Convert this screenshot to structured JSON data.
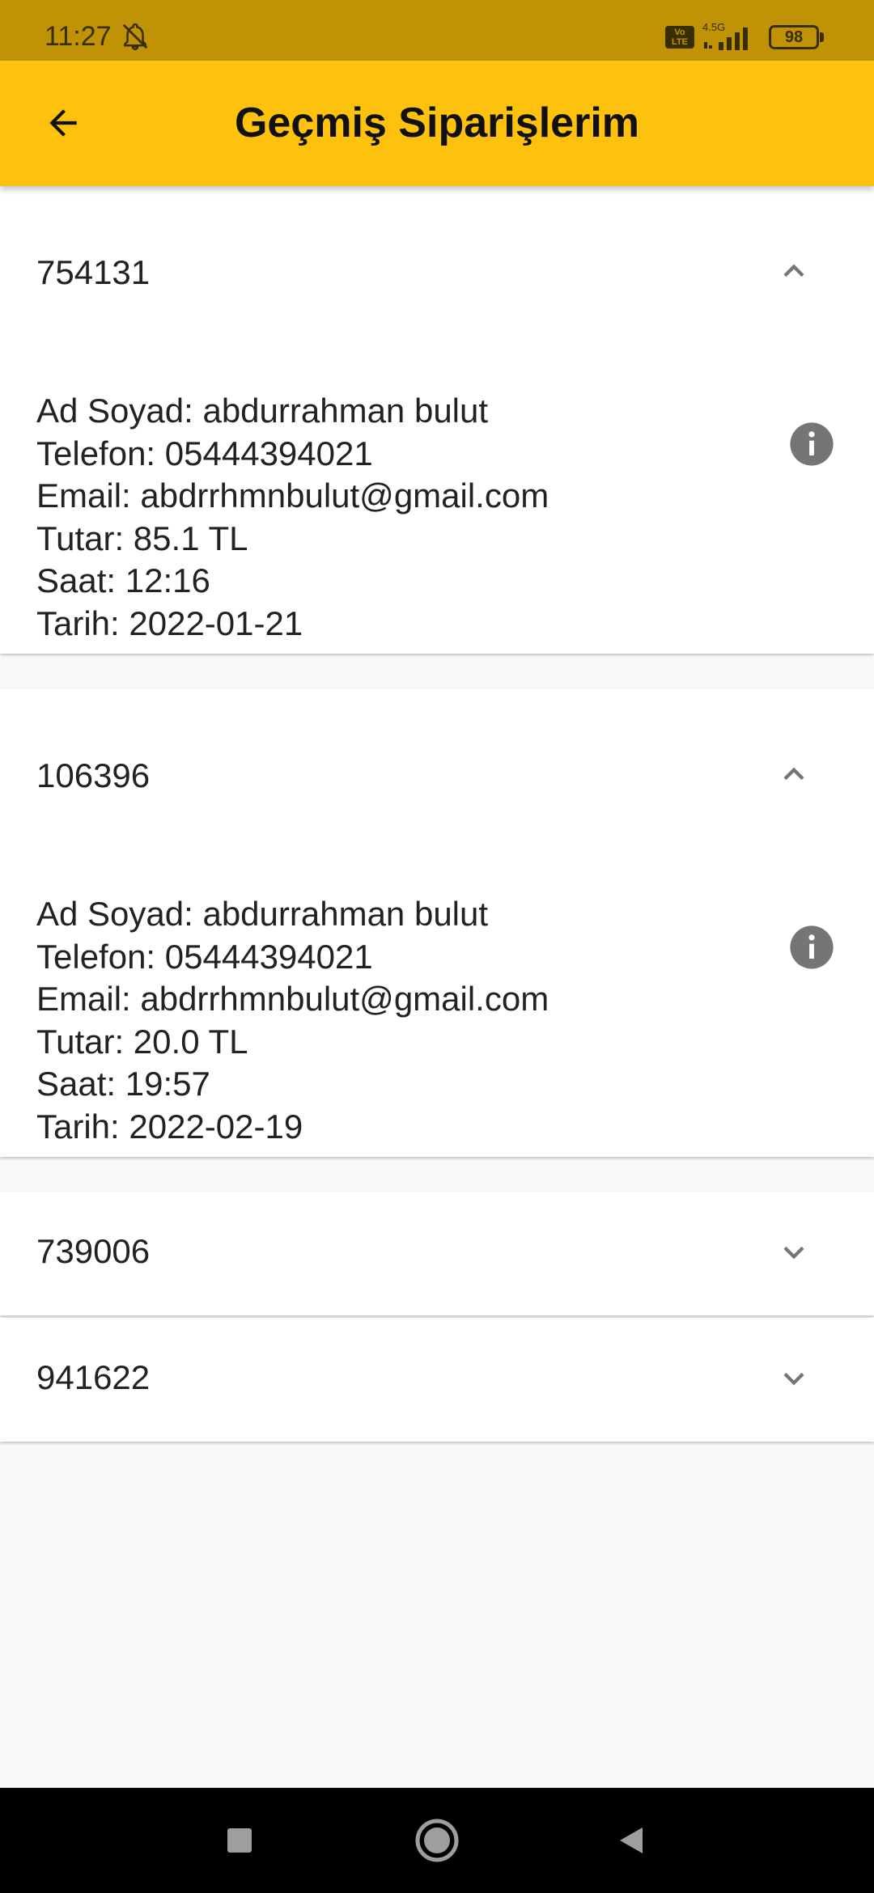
{
  "status_bar": {
    "time": "11:27",
    "network_label": "4.5G",
    "volte_label": "Vo LTE",
    "battery": "98"
  },
  "app_bar": {
    "title": "Geçmiş Siparişlerim"
  },
  "orders": [
    {
      "id": "754131",
      "expanded": true,
      "details": {
        "ad_soyad": "Ad Soyad: abdurrahman bulut",
        "telefon": "Telefon: 05444394021",
        "email": "Email: abdrrhmnbulut@gmail.com",
        "tutar": "Tutar: 85.1 TL",
        "saat": "Saat: 12:16",
        "tarih": "Tarih: 2022-01-21"
      }
    },
    {
      "id": "106396",
      "expanded": true,
      "details": {
        "ad_soyad": "Ad Soyad: abdurrahman bulut",
        "telefon": "Telefon: 05444394021",
        "email": "Email: abdrrhmnbulut@gmail.com",
        "tutar": "Tutar: 20.0 TL",
        "saat": "Saat: 19:57",
        "tarih": "Tarih: 2022-02-19"
      }
    },
    {
      "id": "739006",
      "expanded": false
    },
    {
      "id": "941622",
      "expanded": false
    }
  ],
  "colors": {
    "app_bar": "#fec20e",
    "status_bar": "#c09306",
    "background": "#f9f9f9",
    "icon_grey": "#757575"
  },
  "icons": {
    "back": "arrow-left-icon",
    "collapse": "chevron-up-icon",
    "expand": "chevron-down-icon",
    "info": "info-circle-icon",
    "nav_recents": "square-icon",
    "nav_home": "circle-icon",
    "nav_back": "triangle-back-icon"
  }
}
